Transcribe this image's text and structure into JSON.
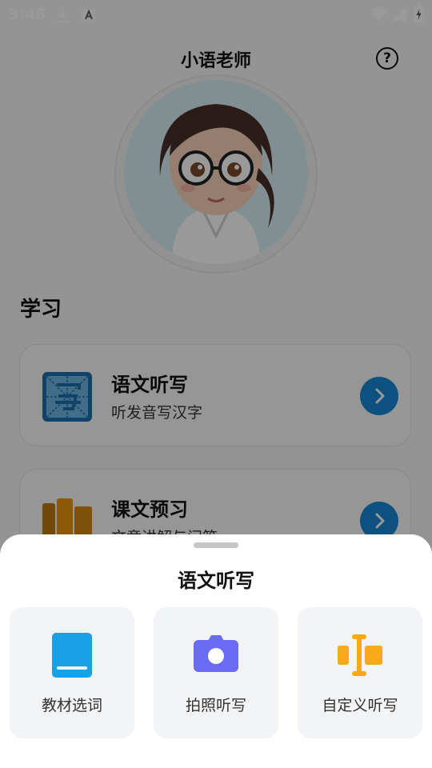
{
  "status_bar": {
    "time": "3:46"
  },
  "header": {
    "title": "小语老师",
    "help_glyph": "?"
  },
  "main": {
    "section_title": "学习",
    "cards": [
      {
        "title": "语文听写",
        "subtitle": "听发音写汉字",
        "icon": "dictation-grid-icon"
      },
      {
        "title": "课文预习",
        "subtitle": "文章讲解与问答",
        "icon": "books-icon"
      }
    ]
  },
  "sheet": {
    "title": "语文听写",
    "options": [
      {
        "label": "教材选词",
        "icon": "book-icon",
        "color": "#1aa0e6"
      },
      {
        "label": "拍照听写",
        "icon": "camera-icon",
        "color": "#6b6cf6"
      },
      {
        "label": "自定义听写",
        "icon": "text-cursor-icon",
        "color": "#f9a91b"
      }
    ]
  },
  "colors": {
    "accent": "#1787d6",
    "sheet_bg": "#ffffff",
    "option_bg": "#f3f4f6"
  }
}
